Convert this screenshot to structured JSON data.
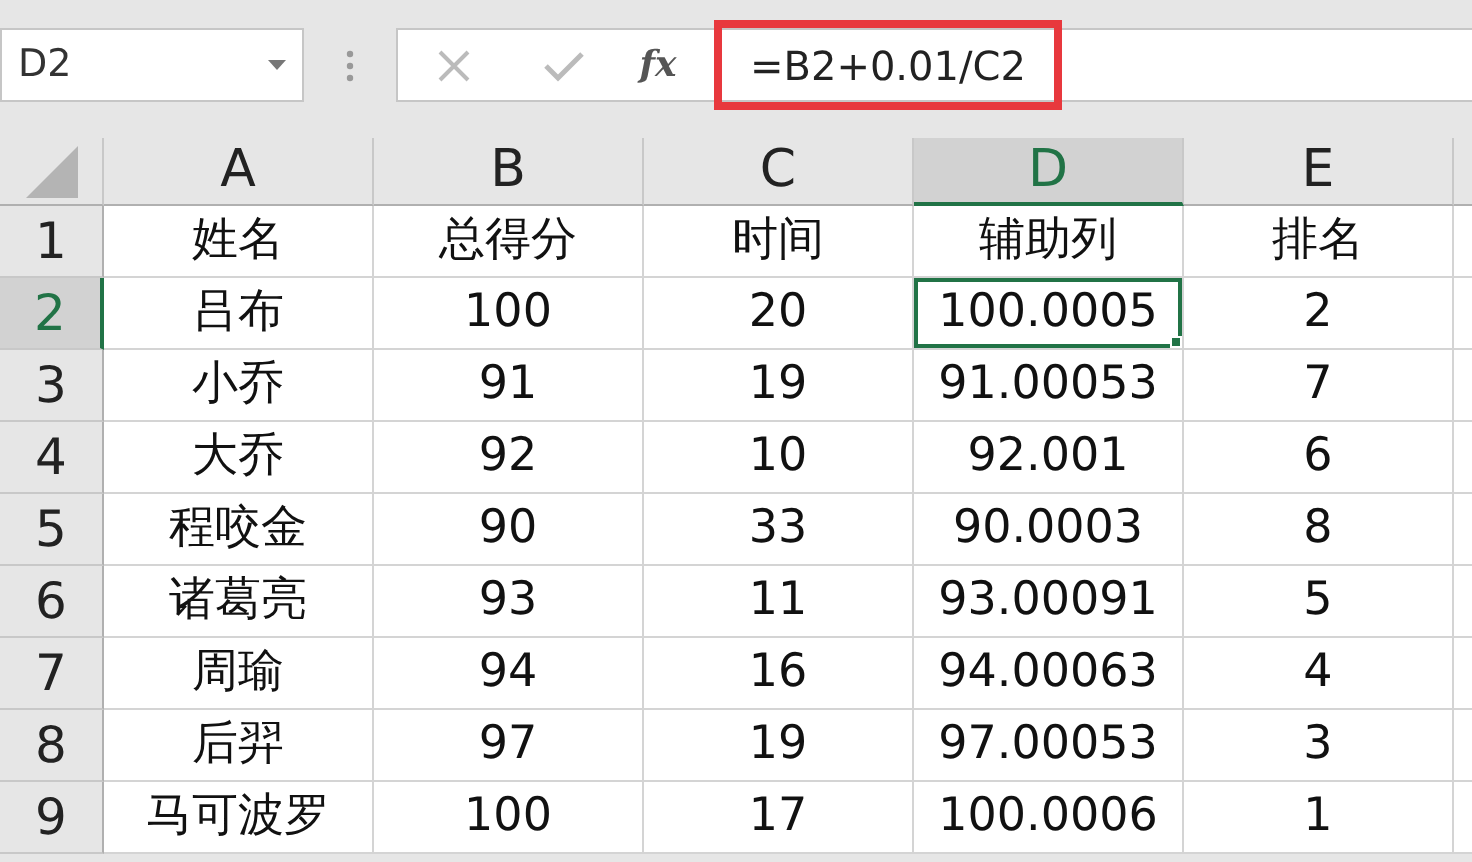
{
  "name_box": {
    "value": "D2"
  },
  "formula_bar": {
    "function_label": "fx",
    "formula": "=B2+0.01/C2",
    "highlighted": true
  },
  "columns": [
    {
      "label": "A",
      "selected": false
    },
    {
      "label": "B",
      "selected": false
    },
    {
      "label": "C",
      "selected": false
    },
    {
      "label": "D",
      "selected": true
    },
    {
      "label": "E",
      "selected": false
    }
  ],
  "rows": [
    {
      "header": "1",
      "selected": false,
      "cells": [
        "姓名",
        "总得分",
        "时间",
        "辅助列",
        "排名"
      ]
    },
    {
      "header": "2",
      "selected": true,
      "cells": [
        "吕布",
        "100",
        "20",
        "100.0005",
        "2"
      ]
    },
    {
      "header": "3",
      "selected": false,
      "cells": [
        "小乔",
        "91",
        "19",
        "91.00053",
        "7"
      ]
    },
    {
      "header": "4",
      "selected": false,
      "cells": [
        "大乔",
        "92",
        "10",
        "92.001",
        "6"
      ]
    },
    {
      "header": "5",
      "selected": false,
      "cells": [
        "程咬金",
        "90",
        "33",
        "90.0003",
        "8"
      ]
    },
    {
      "header": "6",
      "selected": false,
      "cells": [
        "诸葛亮",
        "93",
        "11",
        "93.00091",
        "5"
      ]
    },
    {
      "header": "7",
      "selected": false,
      "cells": [
        "周瑜",
        "94",
        "16",
        "94.00063",
        "4"
      ]
    },
    {
      "header": "8",
      "selected": false,
      "cells": [
        "后羿",
        "97",
        "19",
        "97.00053",
        "3"
      ]
    },
    {
      "header": "9",
      "selected": false,
      "cells": [
        "马可波罗",
        "100",
        "17",
        "100.0006",
        "1"
      ]
    }
  ]
}
